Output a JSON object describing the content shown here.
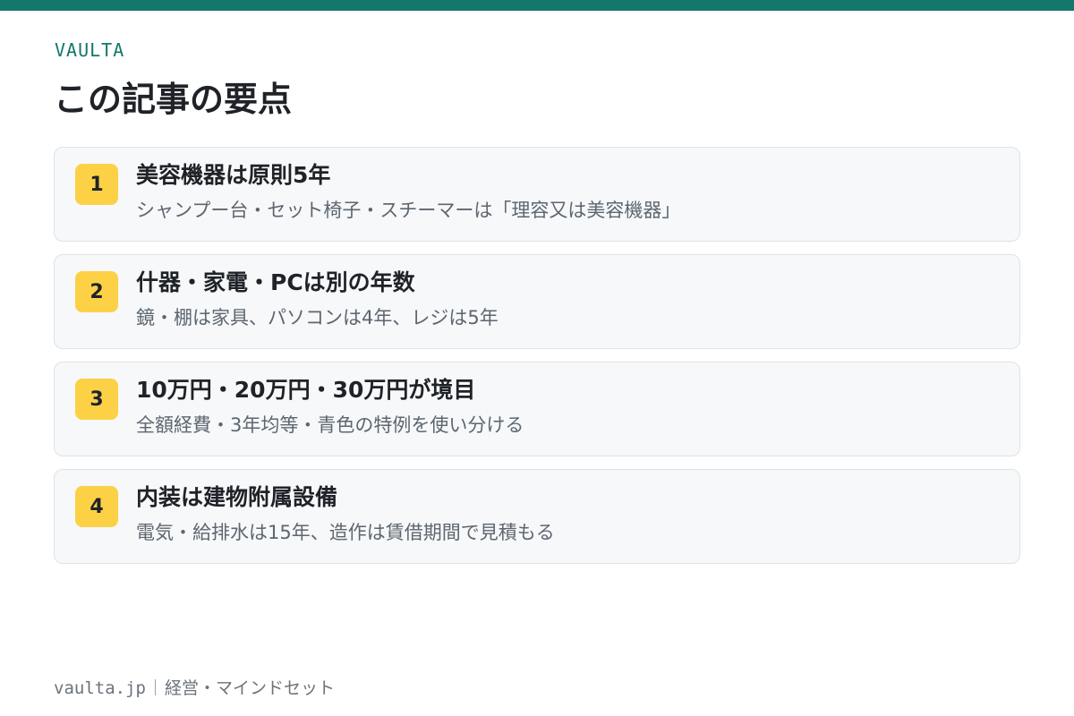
{
  "brand": "VAULTA",
  "page_title": "この記事の要点",
  "items": [
    {
      "number": "1",
      "title": "美容機器は原則5年",
      "description": "シャンプー台・セット椅子・スチーマーは「理容又は美容機器」"
    },
    {
      "number": "2",
      "title": "什器・家電・PCは別の年数",
      "description": "鏡・棚は家具、パソコンは4年、レジは5年"
    },
    {
      "number": "3",
      "title": "10万円・20万円・30万円が境目",
      "description": "全額経費・3年均等・青色の特例を使い分ける"
    },
    {
      "number": "4",
      "title": "内装は建物附属設備",
      "description": "電気・給排水は15年、造作は賃借期間で見積もる"
    }
  ],
  "footer": {
    "site": "vaulta.jp",
    "category": "経営・マインドセット"
  },
  "colors": {
    "accent": "#13776b",
    "badge": "#fdd146",
    "card_bg": "#f6f8f9",
    "card_border": "#dde3e7"
  }
}
